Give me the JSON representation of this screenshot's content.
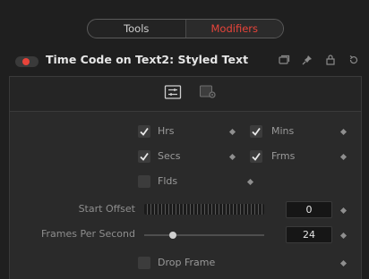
{
  "tabs": [
    {
      "label": "Tools",
      "active": false
    },
    {
      "label": "Modifiers",
      "active": true
    }
  ],
  "accent_color": "#e8443a",
  "header": {
    "title": "Time Code on Text2: Styled Text",
    "icons": [
      "viewer-icon",
      "pin-icon",
      "lock-icon",
      "reset-icon"
    ]
  },
  "panel_tabs": [
    "controls-icon",
    "settings-icon"
  ],
  "controls": {
    "hrs": {
      "label": "Hrs",
      "checked": true
    },
    "mins": {
      "label": "Mins",
      "checked": true
    },
    "secs": {
      "label": "Secs",
      "checked": true
    },
    "frms": {
      "label": "Frms",
      "checked": true
    },
    "flds": {
      "label": "Flds",
      "checked": false
    },
    "start_offset": {
      "label": "Start Offset",
      "value": "0"
    },
    "fps": {
      "label": "Frames Per Second",
      "value": "24"
    },
    "drop_frame": {
      "label": "Drop Frame",
      "checked": false
    }
  }
}
